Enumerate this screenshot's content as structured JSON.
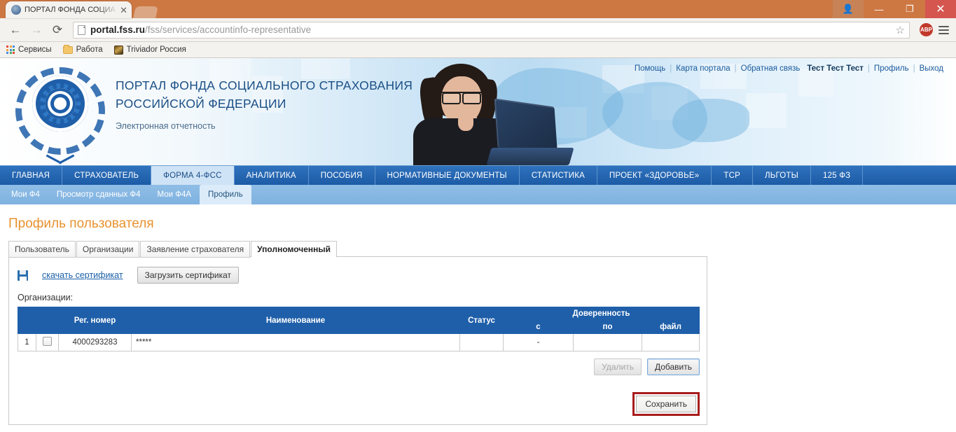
{
  "browser": {
    "tab_title": "ПОРТАЛ ФОНДА СОЦИА",
    "tab_close": "✕",
    "back": "←",
    "forward": "→",
    "reload": "⟳",
    "url_host": "portal.fss.ru",
    "url_path": "/fss/services/accountinfo-representative",
    "star": "☆",
    "abp_label": "ABP",
    "window": {
      "user": "👤",
      "minimize": "—",
      "maximize": "❐",
      "close": "✕"
    },
    "bookmarks": [
      {
        "label": "Сервисы",
        "icon": "apps-grid-icon"
      },
      {
        "label": "Работа",
        "icon": "folder-icon"
      },
      {
        "label": "Triviador Россия",
        "icon": "game-icon"
      }
    ]
  },
  "header": {
    "title_line1": "ПОРТАЛ ФОНДА СОЦИАЛЬНОГО СТРАХОВАНИЯ",
    "title_line2": "РОССИЙСКОЙ ФЕДЕРАЦИИ",
    "subtitle": "Электронная отчетность",
    "top_links": [
      {
        "label": "Помощь"
      },
      {
        "label": "Карта портала"
      },
      {
        "label": "Обратная связь"
      }
    ],
    "user_name": "Тест Тест Тест",
    "profile_link": "Профиль",
    "logout_link": "Выход",
    "separator": "|"
  },
  "main_nav": {
    "items": [
      {
        "label": "ГЛАВНАЯ",
        "active": false
      },
      {
        "label": "СТРАХОВАТЕЛЬ",
        "active": false
      },
      {
        "label": "ФОРМА 4-ФСС",
        "active": true
      },
      {
        "label": "АНАЛИТИКА",
        "active": false
      },
      {
        "label": "ПОСОБИЯ",
        "active": false
      },
      {
        "label": "НОРМАТИВНЫЕ ДОКУМЕНТЫ",
        "active": false
      },
      {
        "label": "СТАТИСТИКА",
        "active": false
      },
      {
        "label": "ПРОЕКТ «ЗДОРОВЬЕ»",
        "active": false
      },
      {
        "label": "ТСР",
        "active": false
      },
      {
        "label": "ЛЬГОТЫ",
        "active": false
      },
      {
        "label": "125 ФЗ",
        "active": false
      }
    ]
  },
  "sub_nav": {
    "items": [
      {
        "label": "Мои Ф4",
        "active": false
      },
      {
        "label": "Просмотр сданных Ф4",
        "active": false
      },
      {
        "label": "Мои Ф4А",
        "active": false
      },
      {
        "label": "Профиль",
        "active": true
      }
    ]
  },
  "content": {
    "page_title": "Профиль пользователя",
    "tabs": [
      {
        "label": "Пользователь",
        "active": false
      },
      {
        "label": "Организации",
        "active": false
      },
      {
        "label": "Заявление страхователя",
        "active": false
      },
      {
        "label": "Уполномоченный",
        "active": true
      }
    ],
    "download_cert_link": "скачать сертификат",
    "upload_cert_button": "Загрузить сертификат",
    "orgs_label": "Организации:",
    "table": {
      "headers": {
        "num": "",
        "check": "",
        "reg_number": "Рег. номер",
        "name": "Наименование",
        "status": "Статус",
        "power_group": "Доверенность",
        "from": "с",
        "to": "по",
        "file": "файл"
      },
      "rows": [
        {
          "num": "1",
          "reg_number": "4000293283",
          "name": "*****",
          "status": "",
          "from": "-",
          "to": "",
          "file": ""
        }
      ]
    },
    "delete_button": "Удалить",
    "add_button": "Добавить",
    "save_button": "Сохранить"
  },
  "colors": {
    "brand_blue": "#1f5fa9",
    "nav_blue": "#2f72bd",
    "subnav_blue": "#8fbde6",
    "title_orange": "#e8922f",
    "highlight_red": "#a81d1d",
    "link_blue": "#1a5fa8"
  }
}
